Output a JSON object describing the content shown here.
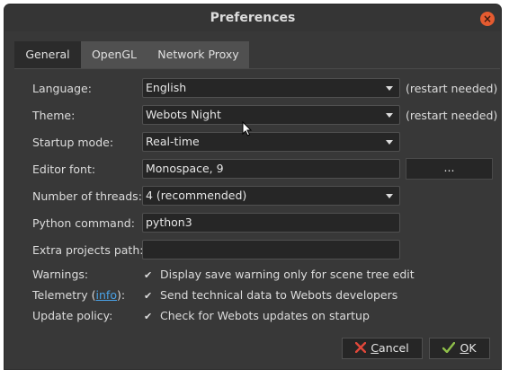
{
  "window": {
    "title": "Preferences"
  },
  "tabs": [
    {
      "label": "General",
      "active": true
    },
    {
      "label": "OpenGL",
      "active": false
    },
    {
      "label": "Network Proxy",
      "active": false
    }
  ],
  "settings": {
    "language": {
      "label": "Language:",
      "value": "English",
      "note": "(restart needed)"
    },
    "theme": {
      "label": "Theme:",
      "value": "Webots Night",
      "note": "(restart needed)"
    },
    "startup_mode": {
      "label": "Startup mode:",
      "value": "Real-time"
    },
    "editor_font": {
      "label": "Editor font:",
      "value": "Monospace, 9",
      "browse_label": "..."
    },
    "threads": {
      "label": "Number of threads:",
      "value": "4 (recommended)"
    },
    "python": {
      "label": "Python command:",
      "value": "python3"
    },
    "extra_path": {
      "label": "Extra projects path:",
      "value": ""
    },
    "warnings": {
      "label": "Warnings:",
      "checked": true,
      "text": "Display save warning only for scene tree edit"
    },
    "telemetry": {
      "label_prefix": "Telemetry (",
      "link": "info",
      "label_suffix": "):",
      "checked": true,
      "text": "Send technical data to Webots developers"
    },
    "update_policy": {
      "label": "Update policy:",
      "checked": true,
      "text": "Check for Webots updates on startup"
    }
  },
  "buttons": {
    "cancel": {
      "prefix": "",
      "mnemonic": "C",
      "rest": "ancel"
    },
    "ok": {
      "mnemonic": "O",
      "rest": "K"
    }
  },
  "colors": {
    "window_bg": "#383838",
    "accent_close": "#e55b30",
    "link": "#4aa3e8",
    "cancel_icon": "#e0473a",
    "ok_icon": "#8fbf4a"
  }
}
